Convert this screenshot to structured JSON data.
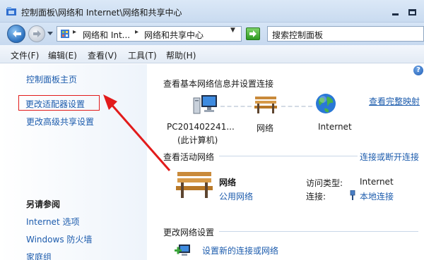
{
  "window": {
    "title": "控制面板\\网络和 Internet\\网络和共享中心"
  },
  "address": {
    "crumbs": [
      "网络和 Int...",
      "网络和共享中心"
    ],
    "search_placeholder": "搜索控制面板"
  },
  "menu": [
    "文件(F)",
    "编辑(E)",
    "查看(V)",
    "工具(T)",
    "帮助(H)"
  ],
  "left_panel": {
    "home": "控制面板主页",
    "adapter": "更改适配器设置",
    "advanced_sharing": "更改高级共享设置",
    "see_also_title": "另请参阅",
    "see_also": [
      "Internet 选项",
      "Windows 防火墙",
      "家庭组"
    ]
  },
  "main": {
    "header": "查看基本网络信息并设置连接",
    "full_map": "查看完整映射",
    "map": {
      "computer": "PC201402241...",
      "computer_sub": "(此计算机)",
      "network": "网络",
      "internet": "Internet"
    },
    "active_networks": {
      "title": "查看活动网络",
      "connect_link": "连接或断开连接",
      "network_name": "网络",
      "network_type": "公用网络",
      "access_label": "访问类型:",
      "access_value": "Internet",
      "conn_label": "连接:",
      "conn_value": "本地连接"
    },
    "change_settings": {
      "title": "更改网络设置",
      "new_connection": "设置新的连接或网络"
    }
  },
  "annotation": {
    "highlight_color": "#e21b1b"
  }
}
